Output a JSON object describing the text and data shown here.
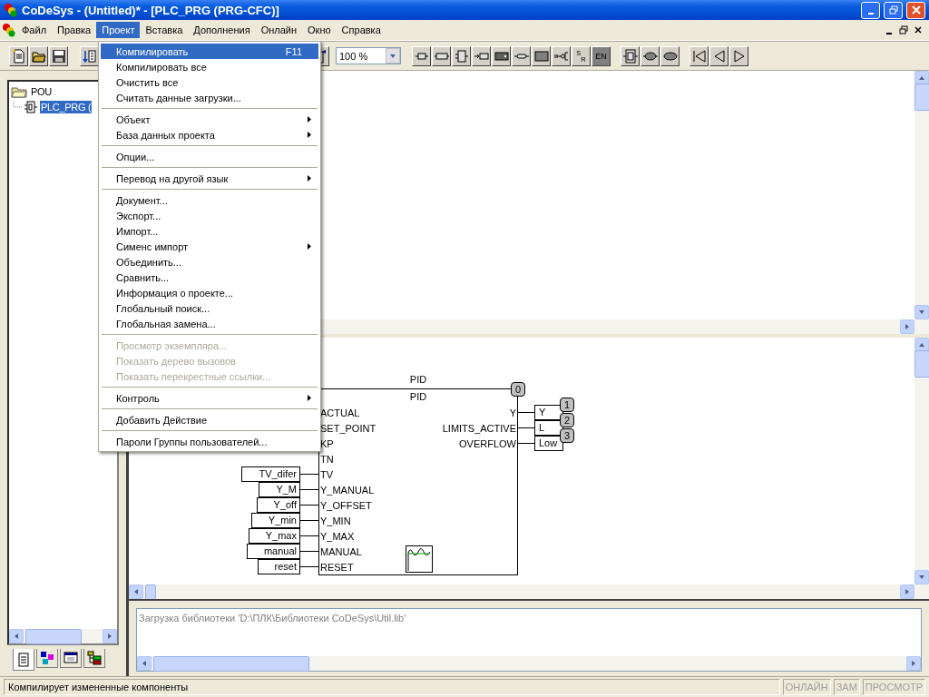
{
  "window": {
    "title": "CoDeSys - (Untitled)* - [PLC_PRG (PRG-CFC)]"
  },
  "menu_bar": [
    {
      "label": "Файл",
      "selected": false
    },
    {
      "label": "Правка",
      "selected": false
    },
    {
      "label": "Проект",
      "selected": true
    },
    {
      "label": "Вставка",
      "selected": false
    },
    {
      "label": "Дополнения",
      "selected": false
    },
    {
      "label": "Онлайн",
      "selected": false
    },
    {
      "label": "Окно",
      "selected": false
    },
    {
      "label": "Справка",
      "selected": false
    }
  ],
  "toolbar": {
    "left_buttons": [
      {
        "kind": "new"
      },
      {
        "kind": "open"
      },
      {
        "kind": "save"
      },
      {
        "kind": "sort"
      }
    ],
    "right_of_menu": [
      {
        "kind": "online"
      }
    ],
    "zoom": {
      "value": "100 %"
    },
    "cfc_groups": [
      [
        {
          "kind": "box"
        },
        {
          "kind": "box-wide"
        },
        {
          "kind": "box-tall"
        },
        {
          "kind": "input"
        },
        {
          "kind": "box-dark"
        },
        {
          "kind": "output"
        },
        {
          "kind": "rect"
        },
        {
          "kind": "coil"
        },
        {
          "kind": "set-reset",
          "label": "$^{S}$$_{R}$"
        },
        {
          "kind": "enable",
          "label": "EN"
        }
      ],
      [
        {
          "kind": "macro"
        },
        {
          "kind": "oval"
        },
        {
          "kind": "oval-wide"
        }
      ],
      [
        {
          "kind": "first"
        },
        {
          "kind": "back"
        },
        {
          "kind": "forward"
        }
      ]
    ]
  },
  "project_menu": {
    "items": [
      {
        "kind": "item",
        "label": "Компилировать",
        "shortcut": "F11",
        "selected": true,
        "disabled": false,
        "submenu": false
      },
      {
        "kind": "item",
        "label": "Компилировать все",
        "selected": false,
        "disabled": false,
        "submenu": false
      },
      {
        "kind": "item",
        "label": "Очистить все",
        "selected": false,
        "disabled": false,
        "submenu": false
      },
      {
        "kind": "item",
        "label": "Считать данные загрузки...",
        "selected": false,
        "disabled": false,
        "submenu": false
      },
      {
        "kind": "separator"
      },
      {
        "kind": "item",
        "label": "Объект",
        "selected": false,
        "disabled": false,
        "submenu": true
      },
      {
        "kind": "item",
        "label": "База данных проекта",
        "selected": false,
        "disabled": false,
        "submenu": true
      },
      {
        "kind": "separator"
      },
      {
        "kind": "item",
        "label": "Опции...",
        "selected": false,
        "disabled": false,
        "submenu": false
      },
      {
        "kind": "separator"
      },
      {
        "kind": "item",
        "label": "Перевод на другой язык",
        "selected": false,
        "disabled": false,
        "submenu": true
      },
      {
        "kind": "separator"
      },
      {
        "kind": "item",
        "label": "Документ...",
        "selected": false,
        "disabled": false,
        "submenu": false
      },
      {
        "kind": "item",
        "label": "Экспорт...",
        "selected": false,
        "disabled": false,
        "submenu": false
      },
      {
        "kind": "item",
        "label": "Импорт...",
        "selected": false,
        "disabled": false,
        "submenu": false
      },
      {
        "kind": "item",
        "label": "Сименс импорт",
        "selected": false,
        "disabled": false,
        "submenu": true
      },
      {
        "kind": "item",
        "label": "Объединить...",
        "selected": false,
        "disabled": false,
        "submenu": false
      },
      {
        "kind": "item",
        "label": "Сравнить...",
        "selected": false,
        "disabled": false,
        "submenu": false
      },
      {
        "kind": "item",
        "label": "Информация о проекте...",
        "selected": false,
        "disabled": false,
        "submenu": false
      },
      {
        "kind": "item",
        "label": "Глобальный поиск...",
        "selected": false,
        "disabled": false,
        "submenu": false
      },
      {
        "kind": "item",
        "label": "Глобальная замена...",
        "selected": false,
        "disabled": false,
        "submenu": false
      },
      {
        "kind": "separator"
      },
      {
        "kind": "item",
        "label": "Просмотр экземпляра...",
        "selected": false,
        "disabled": true,
        "submenu": false
      },
      {
        "kind": "item",
        "label": "Показать дерево вызовов",
        "selected": false,
        "disabled": true,
        "submenu": false
      },
      {
        "kind": "item",
        "label": "Показать перекрестные ссылки...",
        "selected": false,
        "disabled": true,
        "submenu": false
      },
      {
        "kind": "separator"
      },
      {
        "kind": "item",
        "label": "Контроль",
        "selected": false,
        "disabled": false,
        "submenu": true
      },
      {
        "kind": "separator"
      },
      {
        "kind": "item",
        "label": "Добавить Действие",
        "selected": false,
        "disabled": false,
        "submenu": false
      },
      {
        "kind": "separator"
      },
      {
        "kind": "item",
        "label": "Пароли Группы пользователей...",
        "selected": false,
        "disabled": false,
        "submenu": false
      }
    ]
  },
  "tree": {
    "items": [
      {
        "label": "POU",
        "selected": false,
        "expanded": true,
        "children": [
          {
            "label": "PLC_PRG (",
            "selected": true
          }
        ]
      }
    ]
  },
  "tree_tabs": [
    {
      "kind": "pous",
      "selected": true
    },
    {
      "kind": "types",
      "selected": false
    },
    {
      "kind": "visualizations",
      "selected": false
    },
    {
      "kind": "resources",
      "selected": false
    }
  ],
  "cfc_diagram": {
    "block": {
      "instance": "PID",
      "type": "PID",
      "order": "0",
      "inputs": [
        {
          "name": "ACTUAL"
        },
        {
          "name": "SET_POINT"
        },
        {
          "name": "KP"
        },
        {
          "name": "TN"
        },
        {
          "name": "TV",
          "variable": "TV_difer"
        },
        {
          "name": "Y_MANUAL",
          "variable": "Y_M"
        },
        {
          "name": "Y_OFFSET",
          "variable": "Y_off"
        },
        {
          "name": "Y_MIN",
          "variable": "Y_min"
        },
        {
          "name": "Y_MAX",
          "variable": "Y_max"
        },
        {
          "name": "MANUAL",
          "variable": "manual"
        },
        {
          "name": "RESET",
          "variable": "reset"
        }
      ],
      "outputs": [
        {
          "name": "Y",
          "variable": "Y",
          "order": "1"
        },
        {
          "name": "LIMITS_ACTIVE",
          "variable": "L",
          "order": "2"
        },
        {
          "name": "OVERFLOW",
          "variable": "Low",
          "order": "3"
        }
      ]
    }
  },
  "messages": [
    "Загрузка библиотеки 'D:\\ПЛК\\Библиотеки CoDeSys\\Util.lib'"
  ],
  "status_bar": {
    "text": "Компилирует измененные компоненты",
    "indicators": [
      {
        "label": "ОНЛАЙН",
        "active": false
      },
      {
        "label": "ЗАМ",
        "active": false
      },
      {
        "label": "ПРОСМОТР",
        "active": false
      }
    ]
  }
}
